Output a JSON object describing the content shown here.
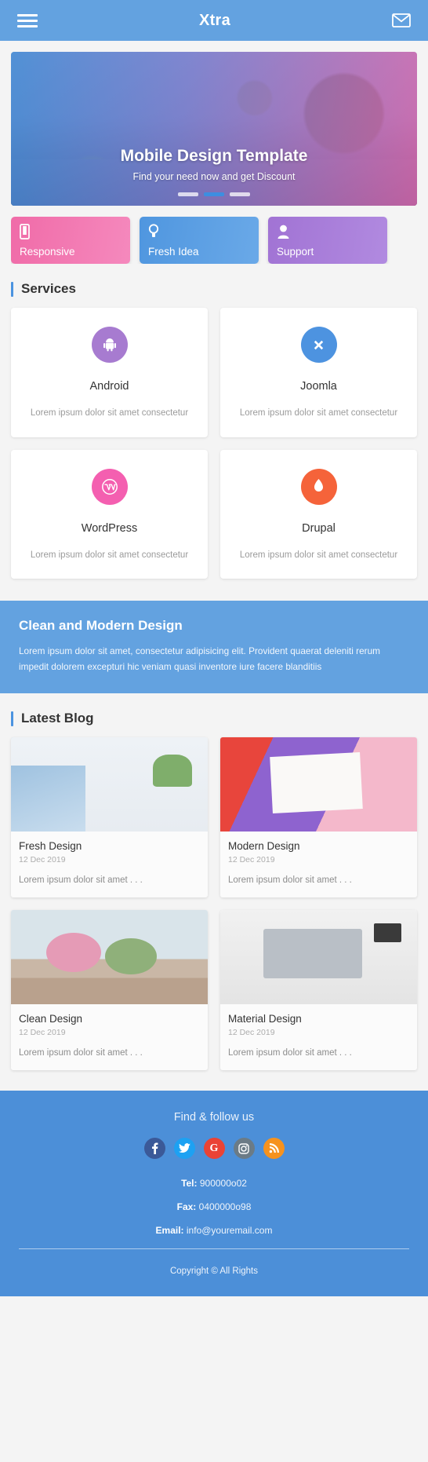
{
  "header": {
    "menu_icon": "hamburger-icon",
    "title": "Xtra",
    "mail_icon": "envelope-icon"
  },
  "hero": {
    "title": "Mobile Design Template",
    "subtitle": "Find your need now and get Discount",
    "dots": [
      "inactive",
      "active",
      "inactive"
    ]
  },
  "features": [
    {
      "label": "Responsive",
      "icon": "mobile-icon",
      "color": "#f06ba8"
    },
    {
      "label": "Fresh Idea",
      "icon": "lightbulb-icon",
      "color": "#4f96df"
    },
    {
      "label": "Support",
      "icon": "user-icon",
      "color": "#a173d4"
    }
  ],
  "services": {
    "heading": "Services",
    "items": [
      {
        "name": "Android",
        "icon": "android-icon",
        "color": "#a77bd0",
        "desc": "Lorem ipsum dolor sit amet consectetur"
      },
      {
        "name": "Joomla",
        "icon": "joomla-icon",
        "color": "#4d93e0",
        "desc": "Lorem ipsum dolor sit amet consectetur"
      },
      {
        "name": "WordPress",
        "icon": "wordpress-icon",
        "color": "#f45fb0",
        "desc": "Lorem ipsum dolor sit amet consectetur"
      },
      {
        "name": "Drupal",
        "icon": "drupal-icon",
        "color": "#f5633a",
        "desc": "Lorem ipsum dolor sit amet consectetur"
      }
    ]
  },
  "banner": {
    "title": "Clean and Modern Design",
    "text": "Lorem ipsum dolor sit amet, consectetur adipisicing elit. Provident quaerat deleniti rerum impedit dolorem excepturi hic veniam quasi inventore iure facere blanditiis",
    "color": "#63a2e0"
  },
  "blog": {
    "heading": "Latest Blog",
    "posts": [
      {
        "title": "Fresh Design",
        "date": "12 Dec 2019",
        "excerpt": "Lorem ipsum dolor sit amet . . ."
      },
      {
        "title": "Modern Design",
        "date": "12 Dec 2019",
        "excerpt": "Lorem ipsum dolor sit amet . . ."
      },
      {
        "title": "Clean Design",
        "date": "12 Dec 2019",
        "excerpt": "Lorem ipsum dolor sit amet . . ."
      },
      {
        "title": "Material Design",
        "date": "12 Dec 2019",
        "excerpt": "Lorem ipsum dolor sit amet . . ."
      }
    ]
  },
  "footer": {
    "follow_title": "Find & follow us",
    "socials": [
      {
        "name": "facebook-icon",
        "glyph": "f",
        "color": "#3b5998"
      },
      {
        "name": "twitter-icon",
        "glyph": "t",
        "color": "#1da1f2"
      },
      {
        "name": "google-icon",
        "glyph": "G",
        "color": "#ea4335"
      },
      {
        "name": "instagram-icon",
        "glyph": "i",
        "color": "#6b7b86"
      },
      {
        "name": "rss-icon",
        "glyph": "r",
        "color": "#f6921e"
      }
    ],
    "tel_label": "Tel:",
    "tel_value": "900000o02",
    "fax_label": "Fax:",
    "fax_value": "0400000o98",
    "email_label": "Email:",
    "email_value": "info@youremail.com",
    "copyright": "Copyright © All Rights",
    "color": "#4c8fd8"
  }
}
